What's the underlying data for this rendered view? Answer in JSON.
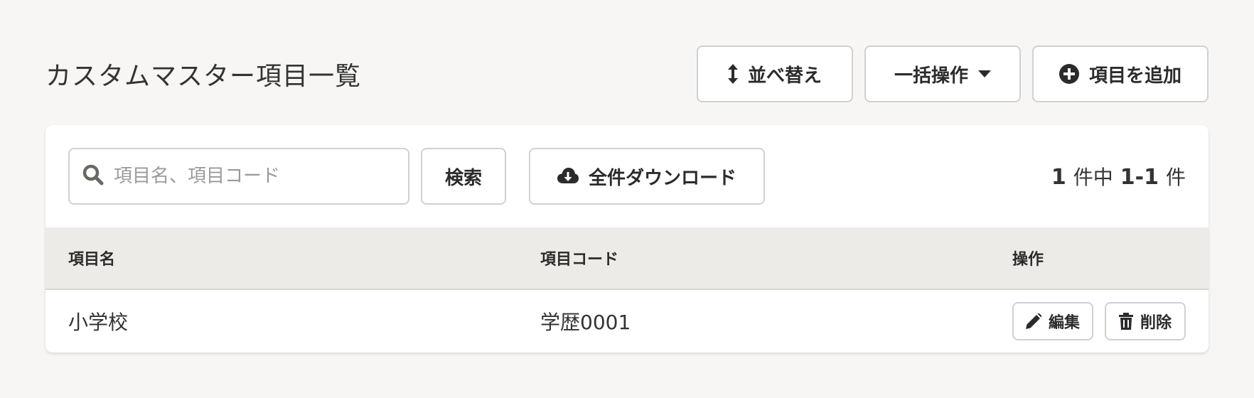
{
  "header": {
    "title": "カスタムマスター項目一覧",
    "sort_label": "並べ替え",
    "bulk_label": "一括操作",
    "add_label": "項目を追加"
  },
  "toolbar": {
    "search_placeholder": "項目名、項目コード",
    "search_value": "",
    "search_button": "検索",
    "download_button": "全件ダウンロード",
    "count": {
      "total": "1",
      "total_suffix": "件中",
      "range": "1-1",
      "range_suffix": "件"
    }
  },
  "table": {
    "columns": [
      "項目名",
      "項目コード",
      "操作"
    ],
    "rows": [
      {
        "name": "小学校",
        "code": "学歴0001",
        "edit_label": "編集",
        "delete_label": "削除"
      }
    ]
  },
  "icons": {
    "sort": "sort-vertical-icon",
    "bulk": "caret-down-icon",
    "add": "plus-circle-icon",
    "search": "search-icon",
    "download": "cloud-download-icon",
    "edit": "pencil-icon",
    "delete": "trash-icon"
  }
}
